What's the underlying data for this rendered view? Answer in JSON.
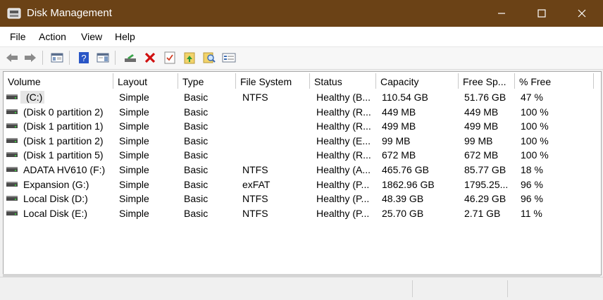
{
  "window": {
    "title": "Disk Management"
  },
  "menu": [
    "File",
    "Action",
    "View",
    "Help"
  ],
  "toolbar": [
    "back-icon",
    "forward-icon",
    "console-tree-icon",
    "help-icon",
    "properties-pane-icon",
    "connect-disk-icon",
    "delete-icon",
    "check-icon",
    "open-folder-icon",
    "explore-icon",
    "properties-icon"
  ],
  "columns": [
    "Volume",
    "Layout",
    "Type",
    "File System",
    "Status",
    "Capacity",
    "Free Sp...",
    "% Free"
  ],
  "rows": [
    [
      "(C:)",
      "Simple",
      "Basic",
      "NTFS",
      "Healthy (B...",
      "110.54 GB",
      "51.76 GB",
      "47 %"
    ],
    [
      "(Disk 0 partition 2)",
      "Simple",
      "Basic",
      "",
      "Healthy (R...",
      "449 MB",
      "449 MB",
      "100 %"
    ],
    [
      "(Disk 1 partition 1)",
      "Simple",
      "Basic",
      "",
      "Healthy (R...",
      "499 MB",
      "499 MB",
      "100 %"
    ],
    [
      "(Disk 1 partition 2)",
      "Simple",
      "Basic",
      "",
      "Healthy (E...",
      "99 MB",
      "99 MB",
      "100 %"
    ],
    [
      "(Disk 1 partition 5)",
      "Simple",
      "Basic",
      "",
      "Healthy (R...",
      "672 MB",
      "672 MB",
      "100 %"
    ],
    [
      "ADATA HV610 (F:)",
      "Simple",
      "Basic",
      "NTFS",
      "Healthy (A...",
      "465.76 GB",
      "85.77 GB",
      "18 %"
    ],
    [
      "Expansion (G:)",
      "Simple",
      "Basic",
      "exFAT",
      "Healthy (P...",
      "1862.96 GB",
      "1795.25...",
      "96 %"
    ],
    [
      "Local Disk (D:)",
      "Simple",
      "Basic",
      "NTFS",
      "Healthy (P...",
      "48.39 GB",
      "46.29 GB",
      "96 %"
    ],
    [
      "Local Disk (E:)",
      "Simple",
      "Basic",
      "NTFS",
      "Healthy (P...",
      "25.70 GB",
      "2.71 GB",
      "11 %"
    ]
  ],
  "colors": {
    "titlebar": "#6b4216",
    "selection": "#e5e5e5"
  }
}
